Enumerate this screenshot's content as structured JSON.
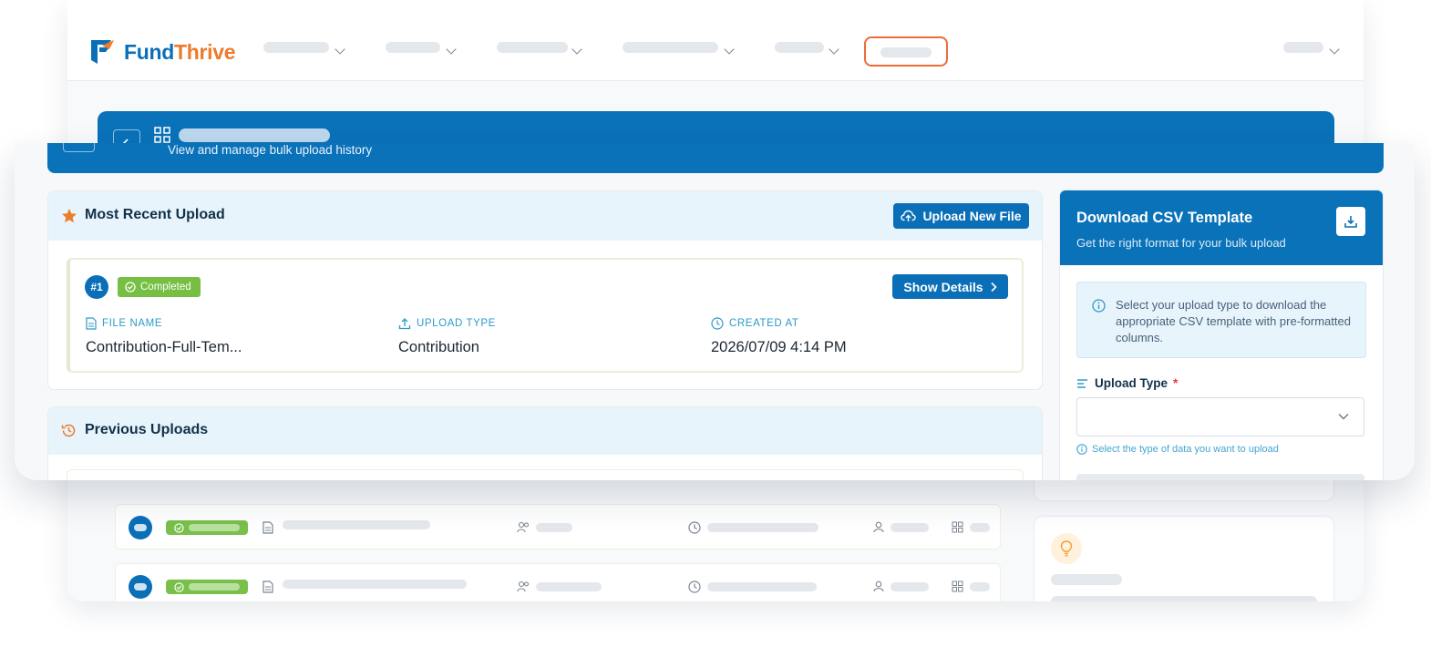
{
  "brand": {
    "name_part1": "Fund",
    "name_part2": "Thrive",
    "colors": {
      "blue": "#0b6fb8",
      "orange": "#ef7a2a",
      "success": "#76bf43"
    }
  },
  "header": {
    "subtitle": "View and manage bulk upload history"
  },
  "recent": {
    "title": "Most Recent Upload",
    "upload_button": "Upload New File",
    "item": {
      "number": "#1",
      "status": "Completed",
      "details_button": "Show Details",
      "file_name_label": "FILE NAME",
      "file_name": "Contribution-Full-Tem...",
      "upload_type_label": "UPLOAD TYPE",
      "upload_type": "Contribution",
      "created_at_label": "CREATED AT",
      "created_at": "2026/07/09 4:14 PM"
    }
  },
  "previous": {
    "title": "Previous Uploads"
  },
  "template": {
    "title": "Download CSV Template",
    "subtitle": "Get the right format for your bulk upload",
    "info": "Select your upload type to download the appropriate CSV template with pre-formatted columns.",
    "field_label": "Upload Type",
    "required_mark": "*",
    "select_value": "",
    "hint": "Select the type of data you want to upload"
  }
}
